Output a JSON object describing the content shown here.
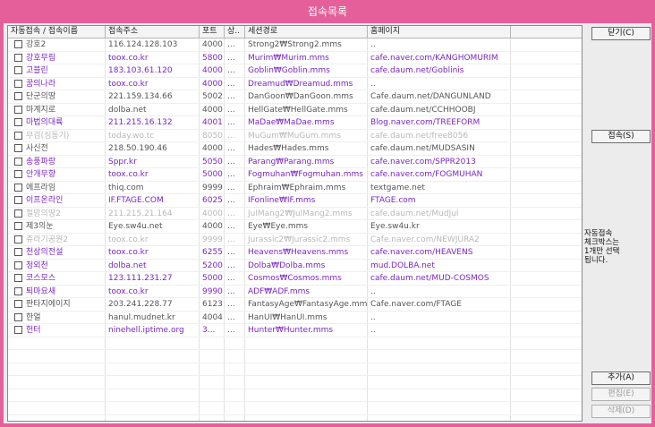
{
  "window": {
    "title": "접속목록"
  },
  "columns": {
    "name": "자동접속 / 접속이름",
    "addr": "접속주소",
    "port": "포트",
    "status": "상..",
    "path": "세션경로",
    "home": "홈페이지"
  },
  "rows": [
    {
      "name": "강호2",
      "addr": "116.124.128.103",
      "port": "4000",
      "status": "...",
      "path": "Strong2₩Strong2.mms",
      "home": "..",
      "color": "#555555"
    },
    {
      "name": "강호무림",
      "addr": "toox.co.kr",
      "port": "5800",
      "status": "...",
      "path": "Murim₩Murim.mms",
      "home": "cafe.naver.com/KANGHOMURIM",
      "color": "#7a26c8"
    },
    {
      "name": "고블린",
      "addr": "183.103.61.120",
      "port": "4000",
      "status": "...",
      "path": "Goblin₩Goblin.mms",
      "home": "cafe.daum.net/Goblinis",
      "color": "#7a26c8"
    },
    {
      "name": "꿈의나라",
      "addr": "toox.co.kr",
      "port": "4000",
      "status": "...",
      "path": "Dreamud₩Dreamud.mms",
      "home": "..",
      "color": "#7a26c8"
    },
    {
      "name": "단군의땅",
      "addr": "221.159.134.66",
      "port": "5002",
      "status": "...",
      "path": "DanGoon₩DanGoon.mms",
      "home": "Cafe.daum.net/DANGUNLAND",
      "color": "#555555"
    },
    {
      "name": "마계지로",
      "addr": "dolba.net",
      "port": "4000",
      "status": "...",
      "path": "HellGate₩HellGate.mms",
      "home": "cafe.daum.net/CCHHOOBJ",
      "color": "#555555"
    },
    {
      "name": "마법의대륙",
      "addr": "211.215.16.132",
      "port": "4001",
      "status": "...",
      "path": "MaDae₩MaDae.mms",
      "home": "Blog.naver.com/TREEFORM",
      "color": "#7a26c8"
    },
    {
      "name": "무검(심동기)",
      "addr": "today.wo.tc",
      "port": "8050",
      "status": "...",
      "path": "MuGum₩MuGum.mms",
      "home": "cafe.daum.net/free8056",
      "color": "#b8b8b8"
    },
    {
      "name": "사신전",
      "addr": "218.50.190.46",
      "port": "4000",
      "status": "...",
      "path": "Hades₩Hades.mms",
      "home": "cafe.daum.net/MUDSASIN",
      "color": "#555555"
    },
    {
      "name": "송풍파랑",
      "addr": "Sppr.kr",
      "port": "5050",
      "status": "...",
      "path": "Parang₩Parang.mms",
      "home": "cafe.naver.com/SPPR2013",
      "color": "#7a26c8"
    },
    {
      "name": "안개무향",
      "addr": "toox.co.kr",
      "port": "5000",
      "status": "...",
      "path": "Fogmuhan₩Fogmuhan.mms",
      "home": "cafe.naver.com/FOGMUHAN",
      "color": "#7a26c8"
    },
    {
      "name": "에프라임",
      "addr": "thiq.com",
      "port": "9999",
      "status": "...",
      "path": "Ephraim₩Ephraim.mms",
      "home": "textgame.net",
      "color": "#555555"
    },
    {
      "name": "이프온라인",
      "addr": "IF.FTAGE.COM",
      "port": "6025",
      "status": "...",
      "path": "IFonline₩IF.mms",
      "home": "FTAGE.com",
      "color": "#7a26c8"
    },
    {
      "name": "절망의땅2",
      "addr": "211.215.21.164",
      "port": "4000",
      "status": "...",
      "path": "JulMang2₩JulMang2.mms",
      "home": "cafe.daum.net/MudJul",
      "color": "#b8b8b8"
    },
    {
      "name": "제3의눈",
      "addr": "Eye.sw4u.net",
      "port": "4000",
      "status": "...",
      "path": "Eye₩Eye.mms",
      "home": "Eye.sw4u.kr",
      "color": "#555555"
    },
    {
      "name": "쥬라기공원2",
      "addr": "toox.co.kr",
      "port": "9999",
      "status": "...",
      "path": "Jurassic2₩Jurassic2.mms",
      "home": "Cafe.naver.com/NEWJURA2",
      "color": "#b8b8b8"
    },
    {
      "name": "천상의전설",
      "addr": "toox.co.kr",
      "port": "6255",
      "status": "...",
      "path": "Heavens₩Heavens.mms",
      "home": "cafe.naver.com/HEAVENS",
      "color": "#7a26c8"
    },
    {
      "name": "청외천",
      "addr": "dolba.net",
      "port": "5200",
      "status": "...",
      "path": "Dolba₩Dolba.mms",
      "home": "mud.DOLBA.net",
      "color": "#7a26c8"
    },
    {
      "name": "코스모스",
      "addr": "123.111.231.27",
      "port": "5000",
      "status": "...",
      "path": "Cosmos₩Cosmos.mms",
      "home": "cafe.daum.net/MUD-COSMOS",
      "color": "#7a26c8"
    },
    {
      "name": "퇴마요새",
      "addr": "toox.co.kr",
      "port": "9990",
      "status": "...",
      "path": "ADF₩ADF.mms",
      "home": "..",
      "color": "#7a26c8"
    },
    {
      "name": "판타지에이지",
      "addr": "203.241.228.77",
      "port": "6123",
      "status": "...",
      "path": "FantasyAge₩FantasyAge.mms",
      "home": "Cafe.naver.com/FTAGE",
      "color": "#555555"
    },
    {
      "name": "한얼",
      "addr": "hanul.mudnet.kr",
      "port": "4004",
      "status": "...",
      "path": "HanUI₩HanUI.mms",
      "home": "..",
      "color": "#555555"
    },
    {
      "name": "헌터",
      "addr": "ninehell.iptime.org",
      "port": "3...",
      "status": "...",
      "path": "Hunter₩Hunter.mms",
      "home": "..",
      "color": "#7a26c8"
    }
  ],
  "buttons": {
    "close": "닫기(C)",
    "connect": "접속(S)",
    "add": "추가(A)",
    "edit": "편집(E)",
    "delete": "삭제(D)"
  },
  "note": {
    "lines": [
      "자동접속",
      "체크박스는",
      "1개만 선택",
      "됩니다."
    ]
  }
}
